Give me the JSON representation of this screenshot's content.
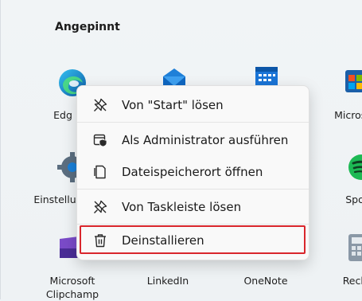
{
  "start_menu": {
    "pinned_title": "Angepinnt",
    "apps": [
      {
        "name": "Edge",
        "icon": "edge-icon"
      },
      {
        "name": "Mail",
        "icon": "mail-icon"
      },
      {
        "name": "Kalender",
        "icon": "calendar-icon"
      },
      {
        "name": "Microsoft Store",
        "icon": "store-icon"
      },
      {
        "name": "Einstellungen",
        "icon": "settings-icon"
      },
      {
        "name": "Spotify",
        "icon": "spotify-icon"
      },
      {
        "name": "Microsoft Clipchamp",
        "icon": "clipchamp-icon"
      },
      {
        "name": "LinkedIn",
        "icon": "linkedin-icon"
      },
      {
        "name": "OneNote",
        "icon": "onenote-icon"
      },
      {
        "name": "Rechner",
        "icon": "calculator-icon"
      }
    ],
    "visible_labels": {
      "edge": "Edg",
      "store": "Microso",
      "settings": "Einstellu",
      "spotify": "Spo",
      "clipchamp_line1": "Microsoft",
      "clipchamp_line2": "Clipchamp",
      "linkedin": "LinkedIn",
      "onenote": "OneNote",
      "calculator": "Rech"
    }
  },
  "context_menu": {
    "items": [
      {
        "label": "Von \"Start\" lösen",
        "icon": "unpin-icon"
      },
      {
        "label": "Als Administrator ausführen",
        "icon": "shield-admin-icon"
      },
      {
        "label": "Dateispeicherort öffnen",
        "icon": "file-location-icon"
      },
      {
        "label": "Von Taskleiste lösen",
        "icon": "unpin-taskbar-icon"
      },
      {
        "label": "Deinstallieren",
        "icon": "trash-icon"
      }
    ],
    "highlighted_item": "Deinstallieren",
    "highlight_color": "#d9262c"
  }
}
